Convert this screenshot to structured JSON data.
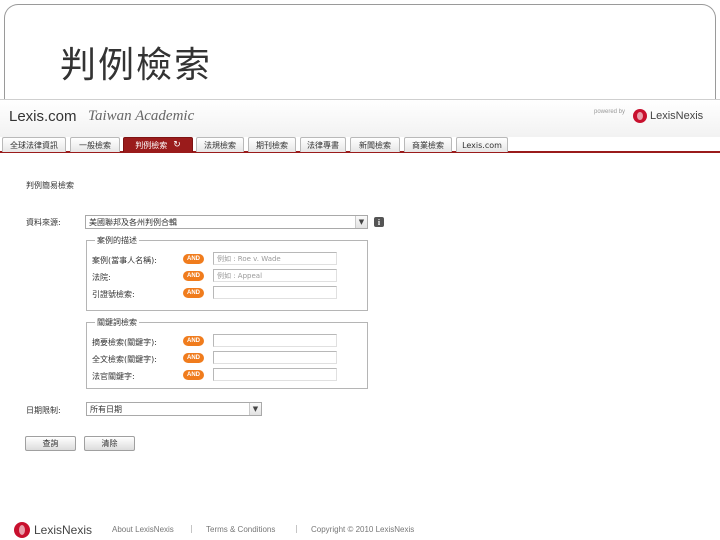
{
  "slide": {
    "title": "判例檢索"
  },
  "header": {
    "brand": "Lexis.com",
    "brand_sub": "Taiwan Academic",
    "powered_by": "powered by",
    "logo_text": "LexisNexis"
  },
  "tabs": [
    {
      "label": "全球法律資訊"
    },
    {
      "label": "一般檢索"
    },
    {
      "label": "判例檢索"
    },
    {
      "label": "法規檢索"
    },
    {
      "label": "期刊檢索"
    },
    {
      "label": "法律專書"
    },
    {
      "label": "新聞檢索"
    },
    {
      "label": "商業檢索"
    },
    {
      "label": "Lexis.com"
    }
  ],
  "form": {
    "section_title": "判例簡易檢索",
    "source_label": "資料來源:",
    "source_value": "美國聯邦及各州判例合輯",
    "group1": {
      "legend": "案例的描述",
      "rows": [
        {
          "label": "案例(當事人名稱):",
          "and": "AND",
          "placeholder": "例如 : Roe v. Wade"
        },
        {
          "label": "法院:",
          "and": "AND",
          "placeholder": "例如 : Appeal"
        },
        {
          "label": "引證號檢索:",
          "and": "AND",
          "placeholder": ""
        }
      ]
    },
    "group2": {
      "legend": "關鍵詞檢索",
      "rows": [
        {
          "label": "摘要檢索(關鍵字):",
          "and": "AND"
        },
        {
          "label": "全文檢索(關鍵字):",
          "and": "AND"
        },
        {
          "label": "法官關鍵字:",
          "and": "AND"
        }
      ]
    },
    "date_label": "日期限制:",
    "date_value": "所有日期",
    "search_button": "查詢",
    "clear_button": "清除"
  },
  "footer": {
    "logo_text": "LexisNexis",
    "about": "About LexisNexis",
    "terms": "Terms & Conditions",
    "copyright": "Copyright © 2010 LexisNexis",
    "separator": "|"
  }
}
